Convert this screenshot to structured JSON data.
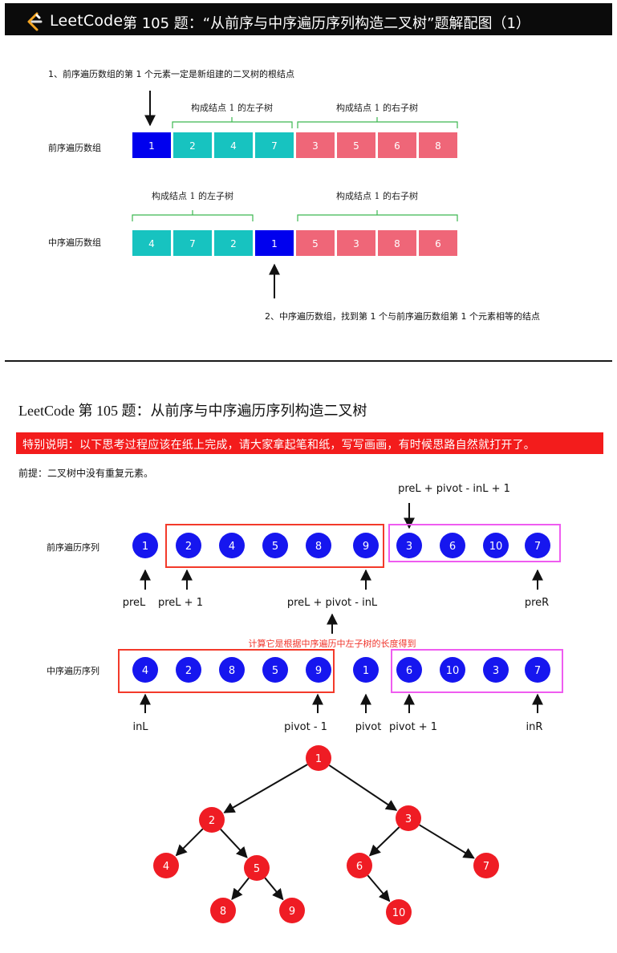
{
  "header": {
    "brand": "LeetCode",
    "title": "第 105 题：“从前序与中序遍历序列构造二叉树”题解配图（1）"
  },
  "figure1": {
    "note_top": "1、前序遍历数组的第 1 个元素一定是新组建的二叉树的根结点",
    "note_bottom": "2、中序遍历数组，找到第 1 个与前序遍历数组第 1 个元素相等的结点",
    "preorder": {
      "label": "前序遍历数组",
      "values": [
        "1",
        "2",
        "4",
        "7",
        "3",
        "5",
        "6",
        "8"
      ],
      "brace_left": "构成结点 1 的左子树",
      "brace_right": "构成结点 1 的右子树"
    },
    "inorder": {
      "label": "中序遍历数组",
      "values": [
        "4",
        "7",
        "2",
        "1",
        "5",
        "3",
        "8",
        "6"
      ],
      "brace_left": "构成结点 1 的左子树",
      "brace_right": "构成结点 1 的右子树"
    },
    "colors": {
      "root": "#0000ee",
      "left": "#17c3c0",
      "right": "#ef6678"
    }
  },
  "figure2": {
    "title": "LeetCode 第 105 题：从前序与中序遍历序列构造二叉树",
    "banner": "特别说明：以下思考过程应该在纸上完成，请大家拿起笔和纸，写写画画，有时候思路自然就打开了。",
    "premise": "前提：二叉树中没有重复元素。",
    "preorder": {
      "label": "前序遍历序列",
      "values": [
        "1",
        "2",
        "4",
        "5",
        "8",
        "9",
        "3",
        "6",
        "10",
        "7"
      ],
      "top_label": "preL + pivot - inL + 1",
      "labels": [
        "preL",
        "preL + 1",
        "preL + pivot - inL",
        "preR"
      ]
    },
    "inorder": {
      "label": "中序遍历序列",
      "values": [
        "4",
        "2",
        "8",
        "5",
        "9",
        "1",
        "6",
        "10",
        "3",
        "7"
      ],
      "labels": [
        "inL",
        "pivot - 1",
        "pivot",
        "pivot + 1",
        "inR"
      ]
    },
    "calc_note": "计算它是根据中序遍历中左子树的长度得到",
    "colors": {
      "node": "#1616ef",
      "left_box": "#f33a2a",
      "right_box": "#ef5cf0",
      "tree_node": "#ef1c24"
    }
  },
  "tree": {
    "nodes": [
      "1",
      "2",
      "3",
      "4",
      "5",
      "6",
      "7",
      "8",
      "9",
      "10"
    ],
    "edges": [
      [
        "1",
        "2"
      ],
      [
        "1",
        "3"
      ],
      [
        "2",
        "4"
      ],
      [
        "2",
        "5"
      ],
      [
        "5",
        "8"
      ],
      [
        "5",
        "9"
      ],
      [
        "3",
        "6"
      ],
      [
        "3",
        "7"
      ],
      [
        "6",
        "10"
      ]
    ]
  }
}
